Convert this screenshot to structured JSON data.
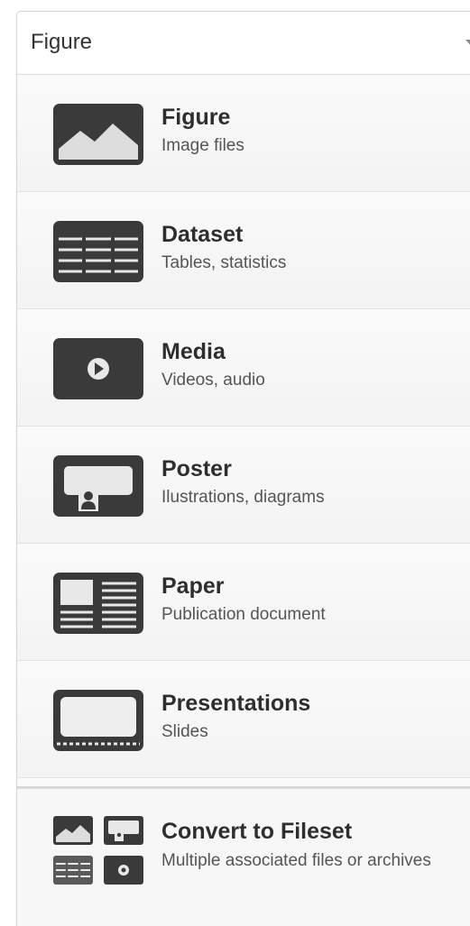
{
  "selector": {
    "value": "Figure"
  },
  "items": [
    {
      "title": "Figure",
      "subtitle": "Image files",
      "icon": "figure-icon"
    },
    {
      "title": "Dataset",
      "subtitle": "Tables, statistics",
      "icon": "dataset-icon"
    },
    {
      "title": "Media",
      "subtitle": "Videos, audio",
      "icon": "media-icon"
    },
    {
      "title": "Poster",
      "subtitle": "Ilustrations, diagrams",
      "icon": "poster-icon"
    },
    {
      "title": "Paper",
      "subtitle": "Publication document",
      "icon": "paper-icon"
    },
    {
      "title": "Presentations",
      "subtitle": "Slides",
      "icon": "presentation-icon"
    }
  ],
  "convert": {
    "title": "Convert to Fileset",
    "subtitle": "Multiple associated files or archives",
    "icon": "fileset-icon"
  },
  "colors": {
    "icon_fill": "#3a3a3a",
    "icon_light": "#dddddd"
  }
}
